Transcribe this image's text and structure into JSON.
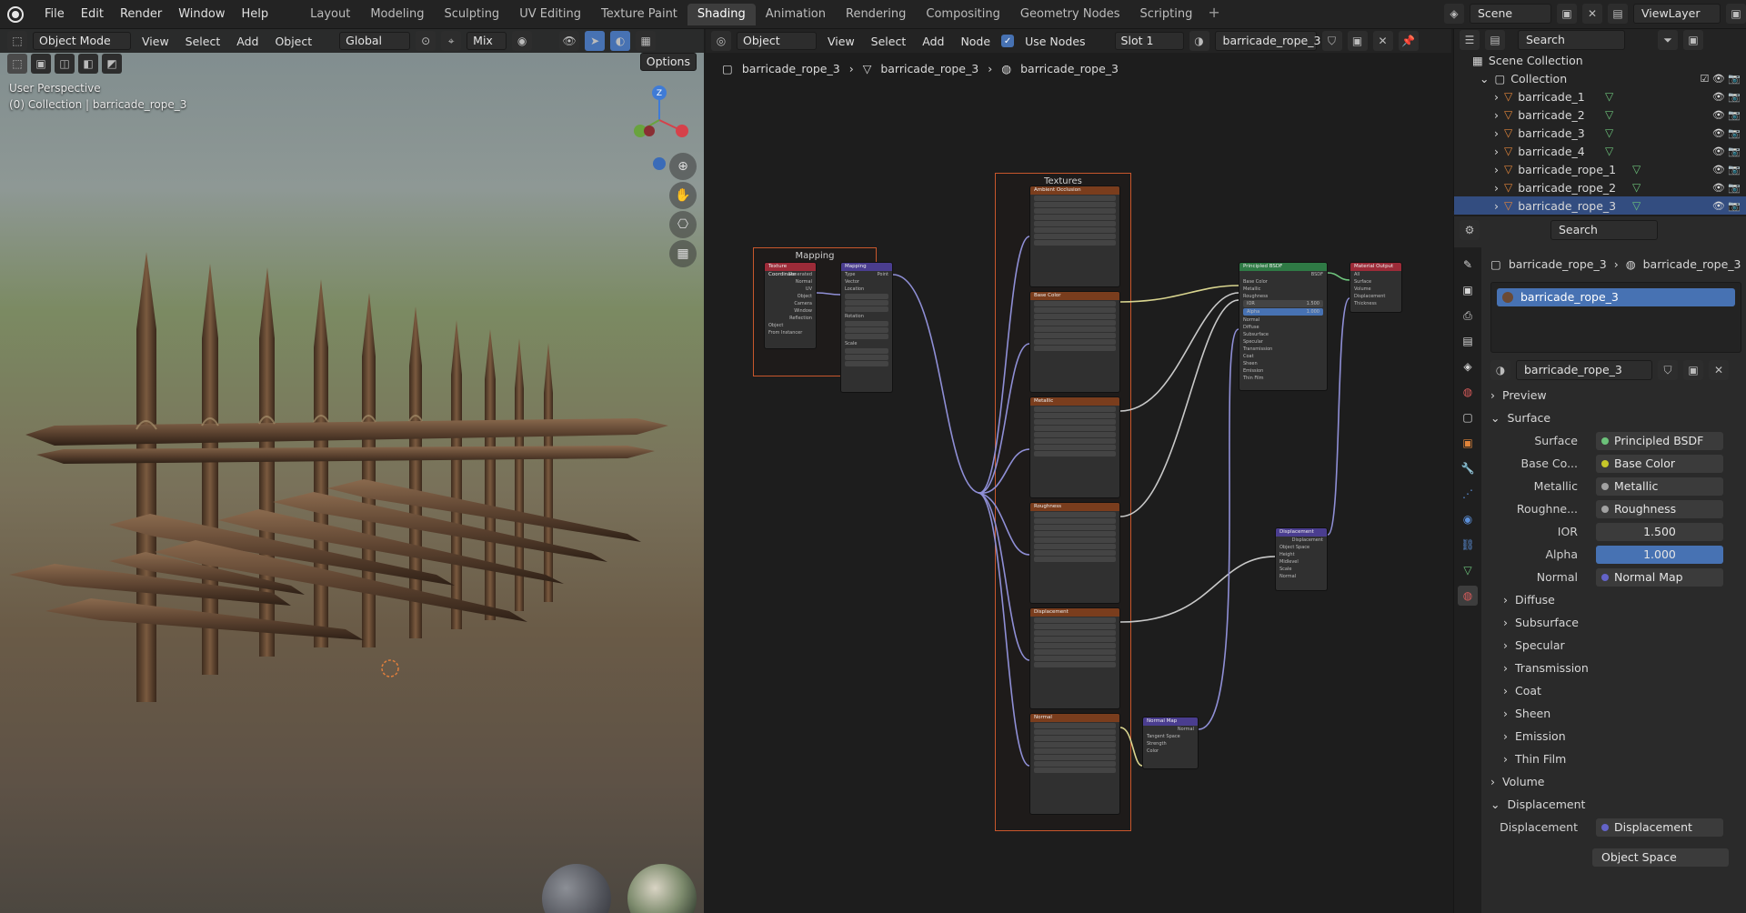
{
  "menu": [
    "File",
    "Edit",
    "Render",
    "Window",
    "Help"
  ],
  "workspaces": [
    "Layout",
    "Modeling",
    "Sculpting",
    "UV Editing",
    "Texture Paint",
    "Shading",
    "Animation",
    "Rendering",
    "Compositing",
    "Geometry Nodes",
    "Scripting"
  ],
  "active_workspace": "Shading",
  "scene": "Scene",
  "view_layer": "ViewLayer",
  "viewport": {
    "mode": "Object Mode",
    "menus": [
      "View",
      "Select",
      "Add",
      "Object"
    ],
    "orientation": "Global",
    "snap_mode": "Mix",
    "options": "Options",
    "perspective": "User Perspective",
    "collection_path": "(0) Collection | barricade_rope_3"
  },
  "node_editor": {
    "type": "Object",
    "menus": [
      "View",
      "Select",
      "Add",
      "Node"
    ],
    "use_nodes": "Use Nodes",
    "slot": "Slot 1",
    "material": "barricade_rope_3",
    "breadcrumb": [
      "barricade_rope_3",
      "barricade_rope_3",
      "barricade_rope_3"
    ],
    "frames": {
      "mapping": "Mapping",
      "textures": "Textures"
    },
    "tex_nodes": [
      "Ambient Occlusion",
      "Base Color",
      "Metallic",
      "Roughness",
      "Displacement",
      "Normal"
    ],
    "texcoord": {
      "title": "Texture Coordinate",
      "outputs": [
        "Generated",
        "Normal",
        "UV",
        "Object",
        "Camera",
        "Window",
        "Reflection"
      ],
      "object": "Object",
      "from_instancer": "From Instancer"
    },
    "mapping": {
      "title": "Mapping",
      "type": "Type",
      "type_value": "Point",
      "vector": "Vector",
      "location": "Location",
      "rotation": "Rotation",
      "scale": "Scale"
    },
    "bsdf": {
      "title": "Principled BSDF",
      "bsdf_out": "BSDF",
      "ior": "IOR",
      "ior_val": "1.500",
      "alpha": "Alpha",
      "alpha_val": "1.000",
      "inputs": [
        "Base Color",
        "Metallic",
        "Roughness"
      ],
      "sections": [
        "Normal",
        "Diffuse",
        "Subsurface",
        "Specular",
        "Transmission",
        "Coat",
        "Sheen",
        "Emission",
        "Thin Film"
      ]
    },
    "output": {
      "title": "Material Output",
      "target": "All",
      "inputs": [
        "Surface",
        "Volume",
        "Displacement",
        "Thickness"
      ]
    },
    "displacement": {
      "title": "Displacement",
      "out": "Displacement",
      "space": "Object Space",
      "inputs": [
        "Height",
        "Midlevel",
        "Scale",
        "Normal"
      ]
    },
    "normal_map": {
      "title": "Normal Map",
      "out": "Normal",
      "space": "Tangent Space",
      "strength": "Strength",
      "color": "Color"
    }
  },
  "outliner": {
    "search": "Search",
    "scene_collection": "Scene Collection",
    "collection": "Collection",
    "objects": [
      "barricade_1",
      "barricade_2",
      "barricade_3",
      "barricade_4",
      "barricade_rope_1",
      "barricade_rope_2",
      "barricade_rope_3"
    ]
  },
  "properties": {
    "search": "Search",
    "breadcrumb": [
      "barricade_rope_3",
      "barricade_rope_3"
    ],
    "slot_item": "barricade_rope_3",
    "material_name": "barricade_rope_3",
    "preview": "Preview",
    "surface_section": "Surface",
    "surface": {
      "label": "Surface",
      "value": "Principled BSDF"
    },
    "inputs": [
      {
        "label": "Base Co...",
        "value": "Base Color",
        "color": "#c7c729"
      },
      {
        "label": "Metallic",
        "value": "Metallic",
        "color": "#a1a1a1"
      },
      {
        "label": "Roughne...",
        "value": "Roughness",
        "color": "#a1a1a1"
      }
    ],
    "ior": {
      "label": "IOR",
      "value": "1.500"
    },
    "alpha": {
      "label": "Alpha",
      "value": "1.000"
    },
    "normal": {
      "label": "Normal",
      "value": "Normal Map"
    },
    "subsections": [
      "Diffuse",
      "Subsurface",
      "Specular",
      "Transmission",
      "Coat",
      "Sheen",
      "Emission",
      "Thin Film"
    ],
    "volume": "Volume",
    "displacement_section": "Displacement",
    "displacement": {
      "label": "Displacement",
      "value": "Displacement"
    },
    "disp_method": "Object Space"
  },
  "colors": {
    "accent": "#4772b3",
    "frame": "#c8572c",
    "texture_header": "#7a3d1d",
    "bsdf_header": "#2f7a45",
    "vector_header": "#4a3d8f"
  }
}
